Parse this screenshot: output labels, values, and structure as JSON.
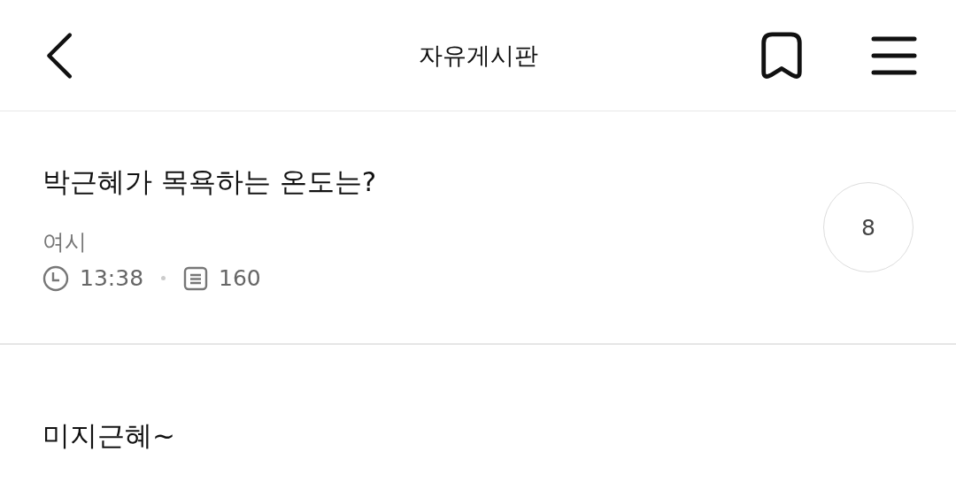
{
  "header": {
    "title": "자유게시판"
  },
  "post": {
    "title": "박근혜가 목욕하는 온도는?",
    "author": "여시",
    "time": "13:38",
    "views": "160",
    "comment_count": "8",
    "body": "미지근혜~"
  }
}
